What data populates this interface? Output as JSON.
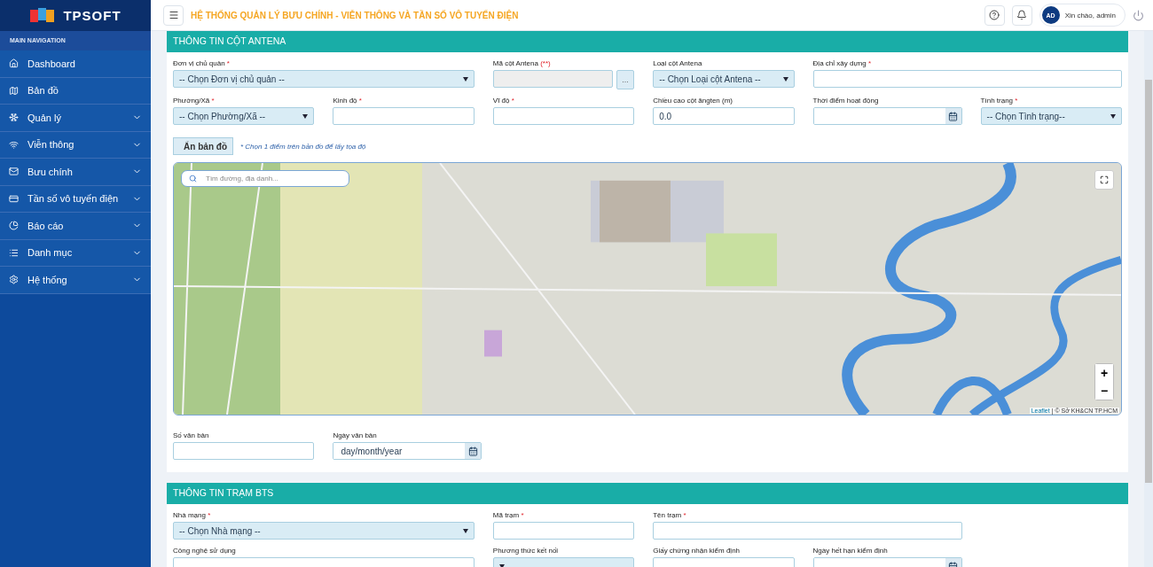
{
  "brand": {
    "name": "TPSOFT"
  },
  "header": {
    "title": "HỆ THỐNG QUẢN LÝ BƯU CHÍNH - VIỄN THÔNG VÀ TẦN SỐ VÔ TUYẾN ĐIỆN",
    "avatar": "AD",
    "greeting": "Xin chào, admin"
  },
  "sidebar": {
    "heading": "MAIN NAVIGATION",
    "items": [
      {
        "label": "Dashboard",
        "expandable": false
      },
      {
        "label": "Bản đồ",
        "expandable": false
      },
      {
        "label": "Quản lý",
        "expandable": true
      },
      {
        "label": "Viễn thông",
        "expandable": true
      },
      {
        "label": "Bưu chính",
        "expandable": true
      },
      {
        "label": "Tần số vô tuyến điện",
        "expandable": true
      },
      {
        "label": "Báo cáo",
        "expandable": true
      },
      {
        "label": "Danh mục",
        "expandable": true
      },
      {
        "label": "Hệ thống",
        "expandable": true
      }
    ]
  },
  "antenna_section": {
    "title": "THÔNG TIN CỘT ANTENA",
    "fields": [
      {
        "kind": "select",
        "label": "Đơn vị chủ quản",
        "mark": "*",
        "value": "-- Chọn Đơn vị chủ quản --"
      },
      {
        "kind": "button_text",
        "label": "Mã cột Antena",
        "mark": "(**)",
        "button": "..."
      },
      {
        "kind": "select",
        "label": "Loại cột Antena",
        "value": "-- Chọn Loại cột Antena --"
      },
      {
        "kind": "text",
        "label": "Địa chỉ xây dựng",
        "mark": "*"
      },
      {
        "kind": "select",
        "label": "Phường/Xã",
        "mark": "*",
        "value": "-- Chọn Phường/Xã --"
      },
      {
        "kind": "text",
        "label": "Kinh độ",
        "mark": "*"
      },
      {
        "kind": "text",
        "label": "Vĩ độ",
        "mark": "*"
      },
      {
        "kind": "text",
        "label": "Chiều cao cột ăngten (m)",
        "value": "0.0"
      },
      {
        "kind": "date",
        "label": "Thời điểm hoạt động"
      },
      {
        "kind": "select",
        "label": "Tình trạng",
        "mark": "*",
        "value": "-- Chọn Tình trạng--"
      }
    ],
    "map_toggle": "Ẩn bản đồ",
    "map_hint": "* Chọn 1 điểm trên bản đồ để lấy tọa độ",
    "map": {
      "search_placeholder": "Tìm đường, địa danh...",
      "zoom_in": "+",
      "zoom_out": "−",
      "attribution_link": "Leaflet",
      "attribution": "| © Sở KH&CN TP.HCM"
    },
    "doc_fields": [
      {
        "kind": "text",
        "label": "Số văn bản"
      },
      {
        "kind": "date",
        "label": "Ngày văn bản",
        "placeholder": "day/month/year"
      }
    ]
  },
  "bts_section": {
    "title": "THÔNG TIN TRẠM BTS",
    "fields": [
      {
        "kind": "select",
        "label": "Nhà mạng",
        "mark": "*",
        "value": "-- Chọn Nhà mạng --"
      },
      {
        "kind": "text",
        "label": "Mã trạm",
        "mark": "*"
      },
      {
        "kind": "text",
        "label": "Tên trạm",
        "mark": "*"
      },
      {
        "kind": "gap"
      },
      {
        "kind": "text",
        "label": "Công nghệ sử dụng"
      },
      {
        "kind": "select",
        "label": "Phương thức kết nối"
      },
      {
        "kind": "text",
        "label": "Giấy chứng nhận kiểm định"
      },
      {
        "kind": "date",
        "label": "Ngày hết hạn kiểm định"
      }
    ]
  }
}
